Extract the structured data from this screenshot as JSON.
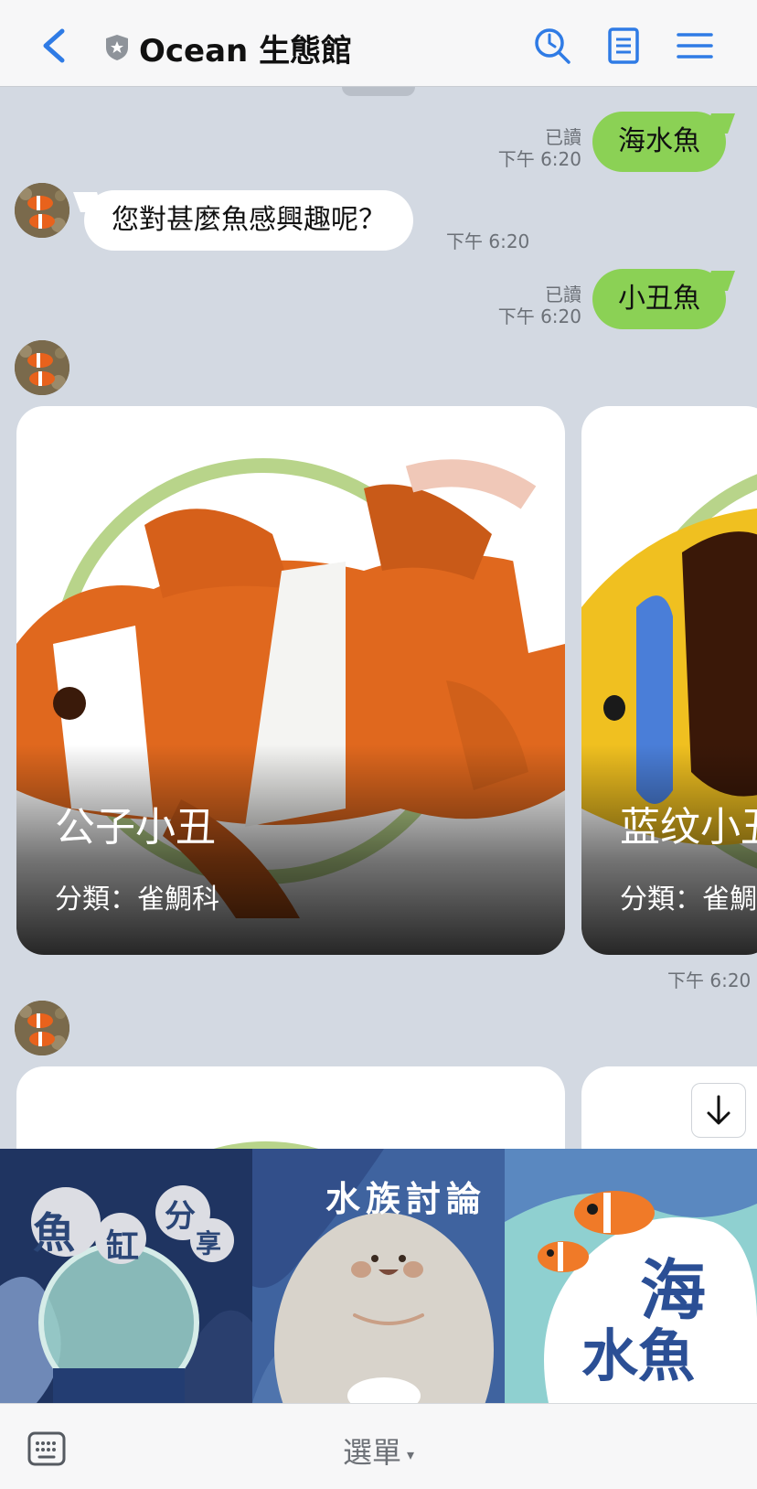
{
  "header": {
    "title": "Ocean 生態館",
    "icons": [
      "back-chevron-icon",
      "shield-star-icon",
      "history-search-icon",
      "notes-icon",
      "hamburger-menu-icon"
    ],
    "accent_color": "#2f7be5"
  },
  "messages": [
    {
      "type": "outgoing",
      "text": "海水魚",
      "read": "已讀",
      "time": "下午 6:20"
    },
    {
      "type": "incoming",
      "text": "您對甚麼魚感興趣呢？",
      "time": "下午 6:20"
    },
    {
      "type": "outgoing",
      "text": "小丑魚",
      "read": "已讀",
      "time": "下午 6:20"
    }
  ],
  "carousel1": {
    "time": "下午 6:20",
    "cards": [
      {
        "title": "公子小丑",
        "subtitle": "分類：雀鯛科"
      },
      {
        "title": "蓝纹小丑",
        "subtitle": "分類：雀鯛科"
      }
    ]
  },
  "banner": {
    "left_text_a": "魚",
    "left_text_b": "缸",
    "left_text_c": "分",
    "left_text_d": "享",
    "mid_text": "水族討論",
    "right_text_a": "海",
    "right_text_b": "水魚"
  },
  "bottom": {
    "menu_label": "選單",
    "caret": "▾"
  },
  "colors": {
    "outgoing_bubble": "#8bd155",
    "chat_bg": "#d3d9e2"
  }
}
